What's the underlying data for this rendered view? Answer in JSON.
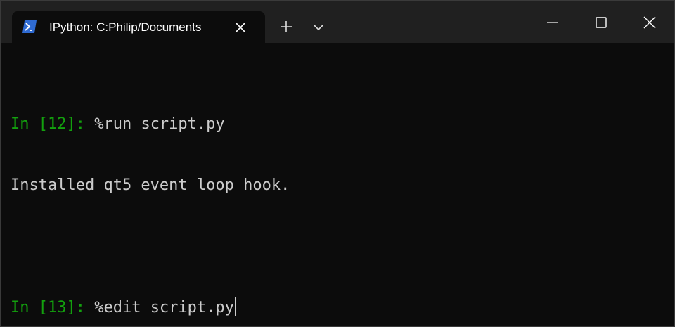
{
  "window": {
    "tab_title": "IPython: C:Philip/Documents",
    "tab_icon": "powershell-icon",
    "accent_color": "#2f6bd3"
  },
  "terminal": {
    "lines": [
      {
        "prompt": "In [12]: ",
        "input": "%run script.py"
      },
      {
        "output": "Installed qt5 event loop hook."
      },
      {
        "blank": ""
      },
      {
        "prompt": "In [13]: ",
        "input": "%edit script.py"
      }
    ],
    "prompt_color": "#13a10e",
    "text_color": "#cccccc"
  }
}
